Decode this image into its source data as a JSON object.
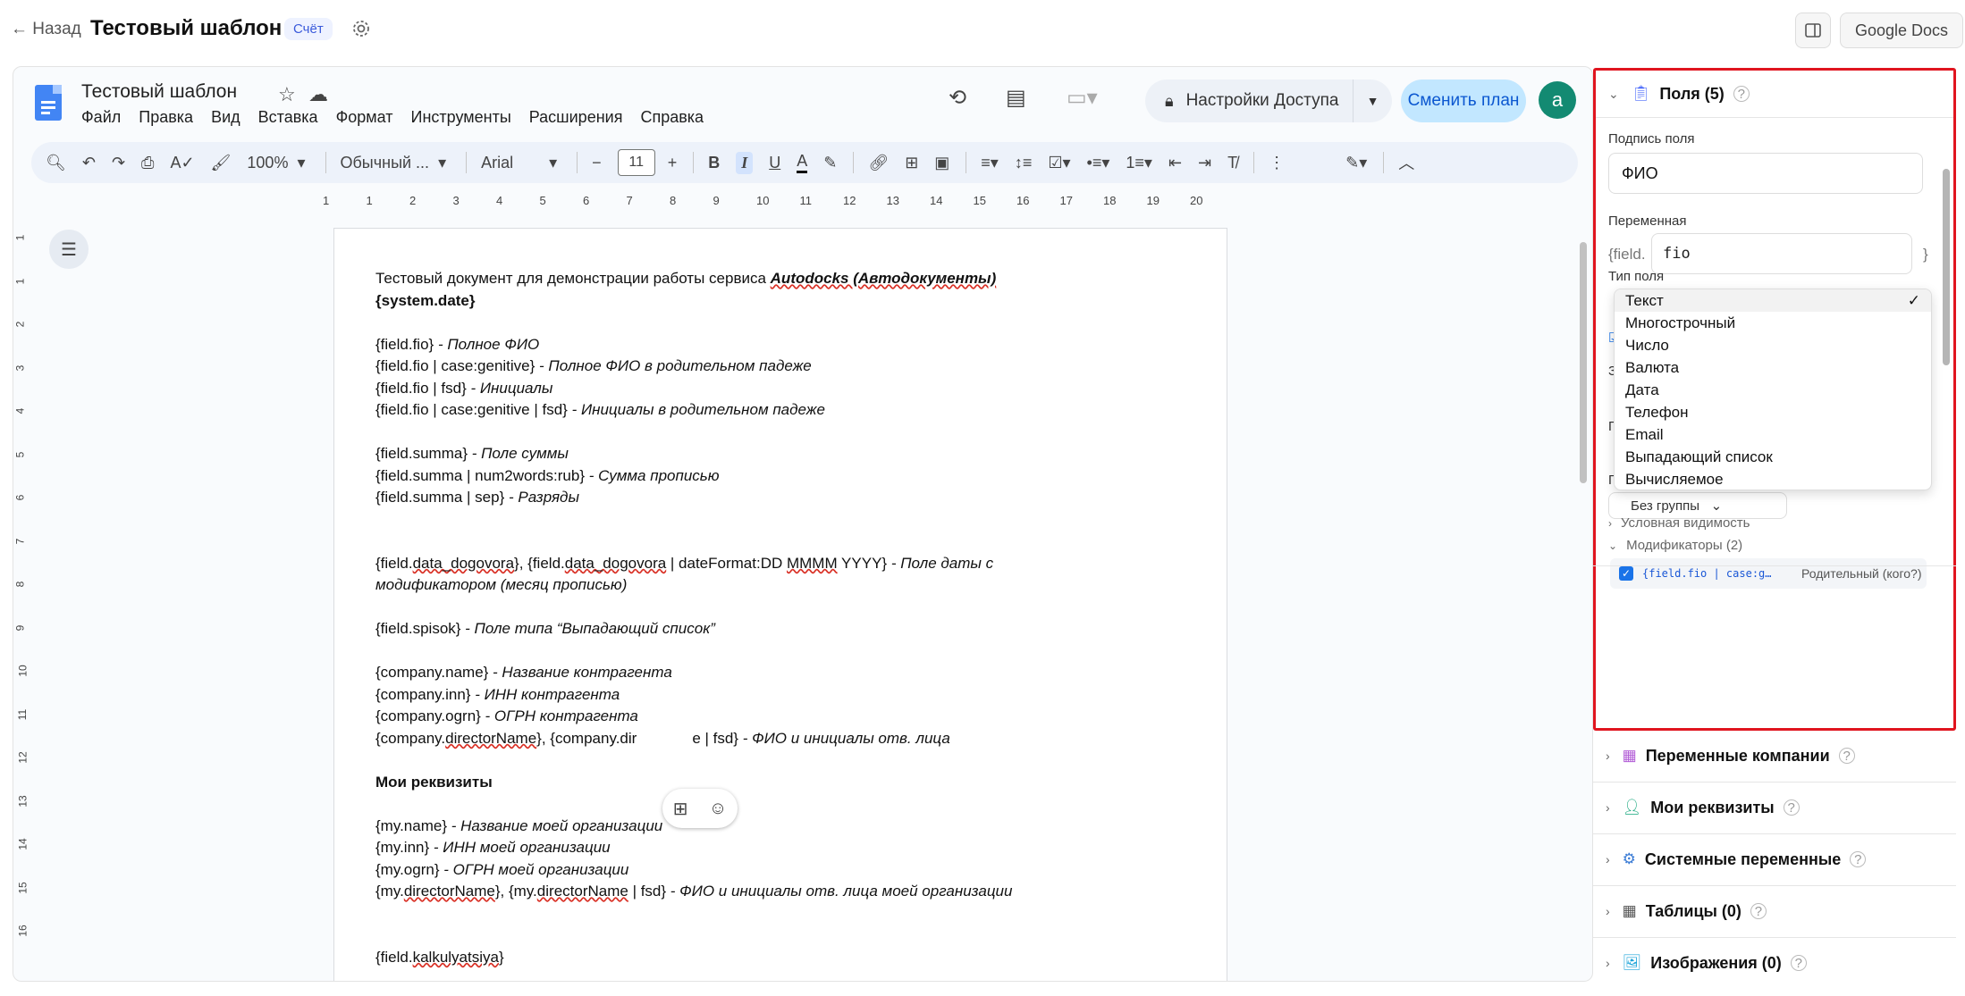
{
  "app": {
    "back_label": "← Назад",
    "title": "Тестовый шаблон",
    "badge": "Счёт",
    "gdocs_label": "Google Docs"
  },
  "docs": {
    "doc_name": "Тестовый шаблон",
    "menu": [
      "Файл",
      "Правка",
      "Вид",
      "Вставка",
      "Формат",
      "Инструменты",
      "Расширения",
      "Справка"
    ],
    "access_label": "Настройки Доступа",
    "plan_label": "Сменить план",
    "avatar_letter": "a",
    "zoom": "100%",
    "style": "Обычный ...",
    "font": "Arial",
    "font_size": "11",
    "ruler": [
      "1",
      "1",
      "2",
      "3",
      "4",
      "5",
      "6",
      "7",
      "8",
      "9",
      "10",
      "11",
      "12",
      "13",
      "14",
      "15",
      "16",
      "17",
      "18",
      "19",
      "20"
    ],
    "vruler": [
      "1",
      "1",
      "2",
      "3",
      "4",
      "5",
      "6",
      "7",
      "8",
      "9",
      "10",
      "11",
      "12",
      "13",
      "14",
      "15",
      "16"
    ]
  },
  "document": {
    "l1_pre": "Тестовый документ для демонстрации работы сервиса ",
    "l1_b": "Autodocks (Автодокументы)",
    "l2": "{system.date}",
    "fio1_a": "{field.fio}",
    "fio1_b": " - Полное ФИО",
    "fio2_a": "{field.fio | case:genitive}",
    "fio2_b": " - Полное ФИО в родительном падеже",
    "fio3_a": "{field.fio | fsd}",
    "fio3_b": " - Инициалы",
    "fio4_a": "{field.fio | case:genitive | fsd}",
    "fio4_b": " - Инициалы в родительном падеже",
    "s1_a": "{field.summa}",
    "s1_b": " - Поле суммы",
    "s2_a": "{field.summa | num2words:rub}",
    "s2_b": " - Сумма прописью",
    "s3_a": "{field.summa | sep}",
    "s3_b": " - Разряды",
    "d1_a": "{field.",
    "d1_u1": "data_dogovora",
    "d1_m": "}, {field.",
    "d1_u2": "data_dogovora",
    "d1_m2": " | dateFormat:DD ",
    "d1_u3": "MMMM",
    "d1_m3": " YYYY}",
    "d1_b": " - Поле даты с",
    "d2": "модификатором (месяц прописью)",
    "sp_a": "{field.spisok}",
    "sp_b": " - Поле типа “Выпадающий список”",
    "c1_a": "{company.name}",
    "c1_b": " - Название контрагента",
    "c2_a": "{company.inn}",
    "c2_b": " - ИНН контрагента",
    "c3_a": "{company.ogrn}",
    "c3_b": " - ОГРН контрагента",
    "c4_a": "{company.",
    "c4_u": "directorName",
    "c4_m": "}, {company.dir",
    "c4_m2": "e | fsd}",
    "c4_b": " - ФИО и инициалы отв. лица",
    "my_head": "Мои реквизиты",
    "m1_a": "{my.name}",
    "m1_b": " - Название моей организации",
    "m2_a": "{my.inn}",
    "m2_b": " - ИНН моей организации",
    "m3_a": "{my.ogrn}",
    "m3_b": " - ОГРН моей организации",
    "m4_a": "{my.",
    "m4_u1": "directorName",
    "m4_m": "}, {my.",
    "m4_u2": "directorName",
    "m4_m2": " | fsd}",
    "m4_b": " - ФИО и инициалы отв. лица моей организации",
    "k_a": "{field.",
    "k_u": "kalkulyatsiya",
    "k_b": "}"
  },
  "panel": {
    "fields_title": "Поля (5)",
    "field_label_caption": "Подпись поля",
    "field_label_value": "ФИО",
    "variable_caption": "Переменная",
    "var_prefix": "{field.",
    "var_value": "fio",
    "var_suffix": "}",
    "type_caption": "Тип поля",
    "type_options": [
      "Текст",
      "Многострочный",
      "Число",
      "Валюта",
      "Дата",
      "Телефон",
      "Email",
      "Выпадающий список",
      "Вычисляемое"
    ],
    "selected_type": "Текст",
    "group_value": "Без группы",
    "cond_visibility": "Условная видимость",
    "modifiers": "Модификаторы (2)",
    "modifier_code": "{field.fio | case:g…",
    "modifier_label": "Родительный (кого?)",
    "sections": [
      "Переменные компании",
      "Мои реквизиты",
      "Системные переменные",
      "Таблицы (0)",
      "Изображения (0)"
    ]
  }
}
